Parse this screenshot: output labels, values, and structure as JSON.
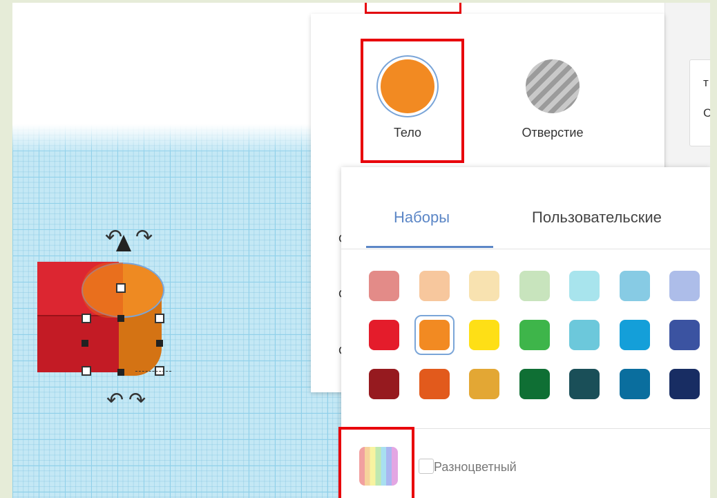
{
  "shape_panel": {
    "solid_label": "Тело",
    "hole_label": "Отверстие",
    "rows": [
      "С",
      "С",
      "С"
    ]
  },
  "right_panel": {
    "line1": "т",
    "line2": "С"
  },
  "color_picker": {
    "tabs": [
      {
        "label": "Наборы",
        "active": true
      },
      {
        "label": "Пользовательские",
        "active": false
      }
    ],
    "swatch_rows": [
      [
        "#e38b88",
        "#f7c79d",
        "#f8e2b0",
        "#c8e4bd",
        "#a8e4ed",
        "#87cbe4",
        "#adbde9"
      ],
      [
        "#e41c2b",
        "#f28a22",
        "#fedf16",
        "#3eb54a",
        "#6cc8db",
        "#149fd9",
        "#3b53a1"
      ],
      [
        "#961a1f",
        "#e25a1c",
        "#e3a734",
        "#0f6f34",
        "#1a4f58",
        "#0a6e9e",
        "#182d63"
      ]
    ],
    "selected_color": "#f28a22",
    "multicolor_label": "Разноцветный"
  },
  "colors": {
    "highlight": "#e8000b",
    "accent": "#5b86c6",
    "grid": "#c4e8f5"
  }
}
